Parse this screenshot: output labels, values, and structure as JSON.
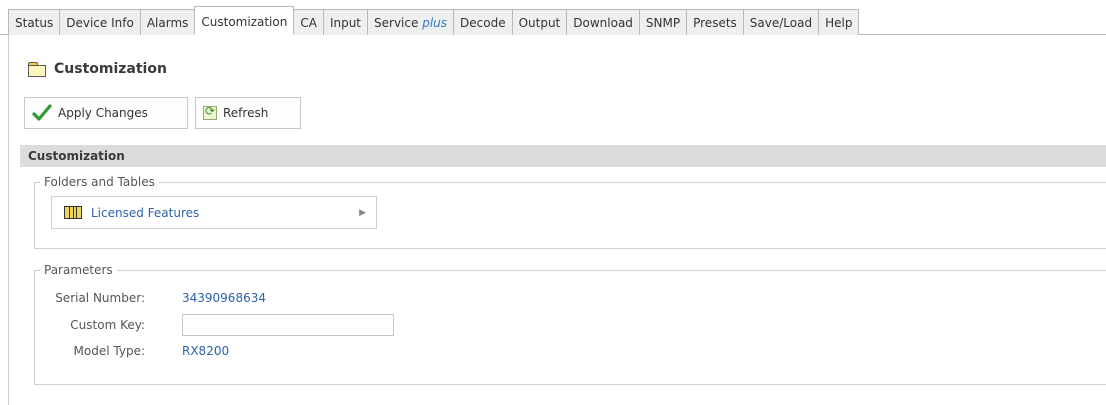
{
  "tabs": [
    {
      "label": "Status"
    },
    {
      "label": "Device Info"
    },
    {
      "label": "Alarms"
    },
    {
      "label": "Customization",
      "active": true
    },
    {
      "label": "CA"
    },
    {
      "label": "Input"
    },
    {
      "label": "Service",
      "suffix": "plus"
    },
    {
      "label": "Decode"
    },
    {
      "label": "Output"
    },
    {
      "label": "Download"
    },
    {
      "label": "SNMP"
    },
    {
      "label": "Presets"
    },
    {
      "label": "Save/Load"
    },
    {
      "label": "Help"
    }
  ],
  "page": {
    "title": "Customization",
    "icon": "folder-icon"
  },
  "toolbar": {
    "apply_label": "Apply Changes",
    "apply_icon": "check-icon",
    "refresh_label": "Refresh",
    "refresh_icon": "refresh-icon"
  },
  "section": {
    "title": "Customization"
  },
  "folders": {
    "legend": "Folders and Tables",
    "items": [
      {
        "label": "Licensed Features",
        "icon": "table-icon"
      }
    ]
  },
  "parameters": {
    "legend": "Parameters",
    "serial_label": "Serial Number:",
    "serial_value": "34390968634",
    "custom_key_label": "Custom Key:",
    "custom_key_value": "",
    "model_label": "Model Type:",
    "model_value": "RX8200"
  },
  "colors": {
    "link": "#2c63a8",
    "accent_plus": "#2f78c6",
    "section_bg": "#dcdcdc"
  }
}
